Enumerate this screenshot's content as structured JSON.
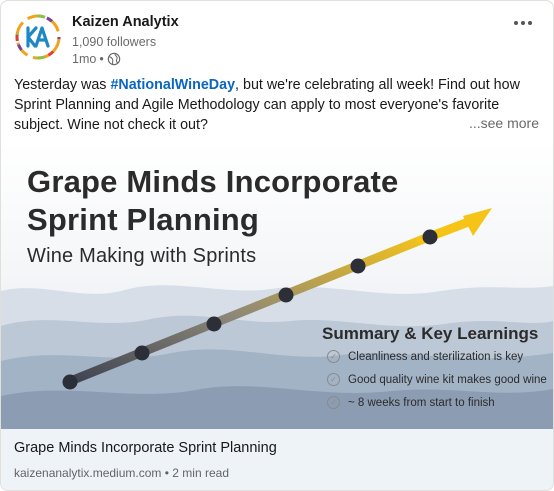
{
  "company": {
    "name": "Kaizen Analytix",
    "followers": "1,090 followers",
    "age": "1mo",
    "separator": "•"
  },
  "post": {
    "text_before": "Yesterday was ",
    "hashtag": "#NationalWineDay",
    "text_after": ", but we're celebrating all week! Find out how Sprint Planning and Agile Methodology can apply to most everyone's favorite subject. Wine not check it out?",
    "see_more": "...see more"
  },
  "image": {
    "title_line1": "Grape Minds Incorporate",
    "title_line2": "Sprint Planning",
    "subtitle": "Wine Making with Sprints",
    "summary_title": "Summary & Key Learnings",
    "learnings": [
      "Cleanliness and sterilization is key",
      "Good quality wine kit makes good wine",
      "~ 8 weeks from start to finish"
    ]
  },
  "link": {
    "title": "Grape Minds Incorporate Sprint Planning",
    "domain": "kaizenanalytix.medium.com",
    "separator": "•",
    "read_time": "2 min read"
  },
  "colors": {
    "hashtag": "#0a66c2",
    "link_bg": "#eef3f8",
    "arrow_start": "#4a4a5a",
    "arrow_end": "#f5c518"
  },
  "icons": {
    "more": "ellipsis-icon",
    "visibility": "globe-icon",
    "checks": "check-circle-icon"
  }
}
